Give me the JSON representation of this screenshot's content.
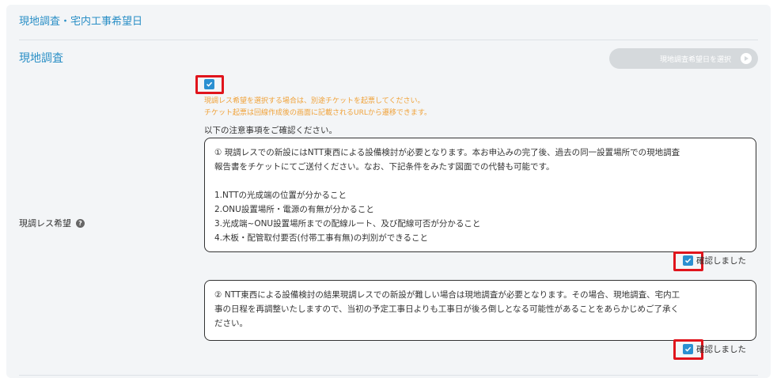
{
  "section_title": "現地調査・宅内工事希望日",
  "sub_title": "現地調査",
  "date_button": {
    "label": "現地調査希望日を選択"
  },
  "field_label": "現調レス希望",
  "warning": {
    "line1": "現調レス希望を選択する場合は、別途チケットを起票してください。",
    "line2": "チケット起票は回線作成後の画面に記載されるURLから遷移できます。"
  },
  "notice_label": "以下の注意事項をご確認ください。",
  "notice1": {
    "lines": [
      "① 現調レスでの新設にはNTT東西による設備検討が必要となります。本お申込みの完了後、過去の同一設置場所での現地調査",
      "報告書をチケットにてご送付ください。なお、下記条件をみたす図面での代替も可能です。",
      "",
      "1.NTTの光成端の位置が分かること",
      "2.ONU設置場所・電源の有無が分かること",
      "3.光成端~ONU設置場所までの配線ルート、及び配線可否が分かること",
      "4.木板・配管取付要否(付帯工事有無)の判別ができること"
    ],
    "confirm_label": "確認しました"
  },
  "notice2": {
    "lines": [
      "② NTT東西による設備検討の結果現調レスでの新設が難しい場合は現地調査が必要となります。その場合、現地調査、宅内工",
      "事の日程を再調整いたしますので、当初の予定工事日よりも工事日が後ろ倒しとなる可能性があることをあらかじめご了承く",
      "ださい。"
    ],
    "confirm_label": "確認しました"
  },
  "colors": {
    "accent": "#2a8fc6",
    "warning": "#f0a23a",
    "highlight": "#e0141c",
    "checkbox": "#2a8fd1"
  }
}
